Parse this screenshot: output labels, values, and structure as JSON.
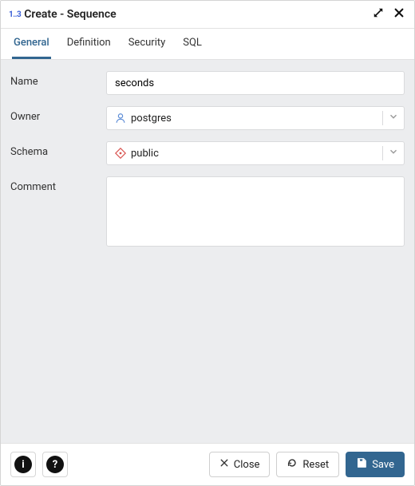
{
  "header": {
    "icon_text": "1..3",
    "title": "Create - Sequence"
  },
  "tabs": [
    {
      "label": "General",
      "active": true
    },
    {
      "label": "Definition",
      "active": false
    },
    {
      "label": "Security",
      "active": false
    },
    {
      "label": "SQL",
      "active": false
    }
  ],
  "form": {
    "name_label": "Name",
    "name_value": "seconds",
    "owner_label": "Owner",
    "owner_value": "postgres",
    "schema_label": "Schema",
    "schema_value": "public",
    "comment_label": "Comment",
    "comment_value": ""
  },
  "footer": {
    "close_label": "Close",
    "reset_label": "Reset",
    "save_label": "Save"
  }
}
